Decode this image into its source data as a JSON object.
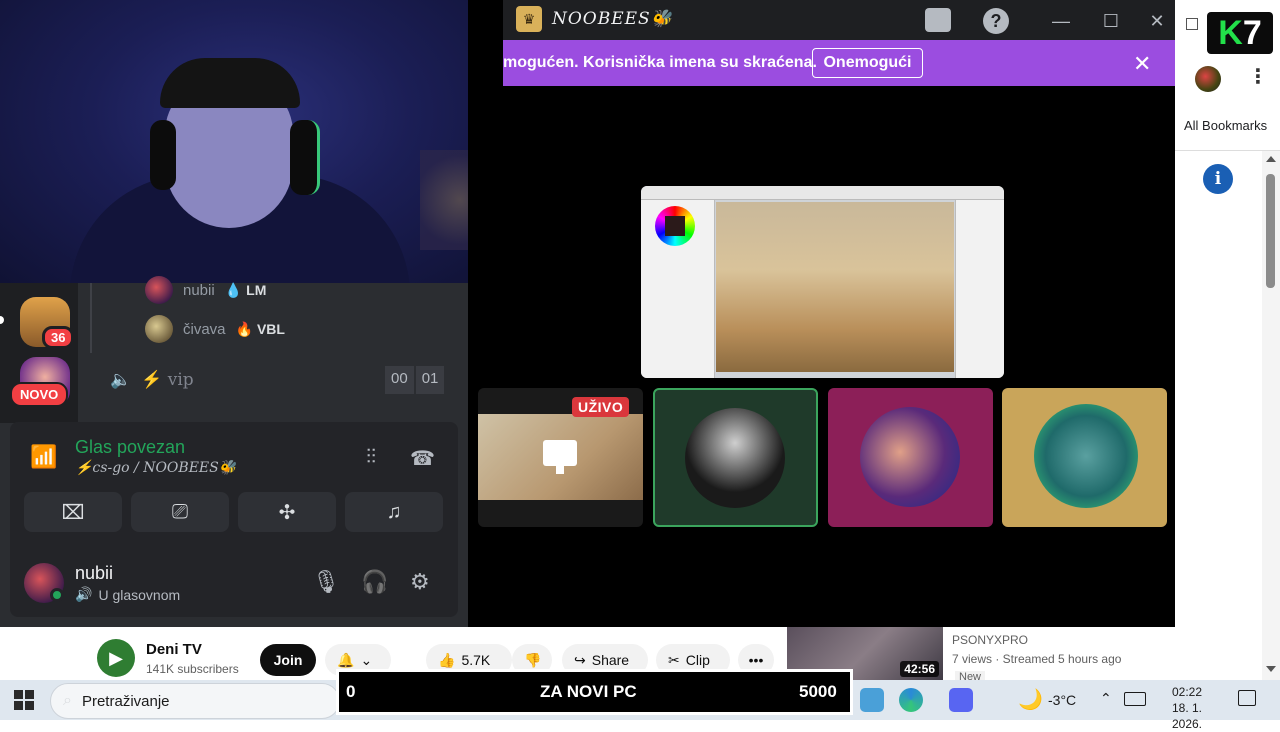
{
  "browser": {
    "bookmarks_label": "All Bookmarks",
    "k7_letter": "K",
    "k7_number": "7",
    "info_icon_glyph": "i",
    "kebab_glyph": "⋮"
  },
  "youtube": {
    "channel_name": "Deni TV",
    "subscribers": "141K subscribers",
    "join_label": "Join",
    "like_count": "5.7K",
    "share_label": "Share",
    "clip_label": "Clip",
    "more_glyph": "•••",
    "related": {
      "duration": "42:56",
      "channel": "PSONYXPRO",
      "meta": "7 views · Streamed 5 hours ago",
      "badge": "New"
    }
  },
  "discord": {
    "window_title": "NOOBEES🐝",
    "notice_text": "mogućen. Korisnička imena su skraćena.",
    "notice_button": "Onemogući",
    "notice_close": "✕",
    "server_badge_count": "36",
    "server_new_label": "NOVO",
    "voice_users": [
      {
        "name": "nubii",
        "tag": "LM",
        "tag_icon": "💧"
      },
      {
        "name": "čivava",
        "tag": "VBL",
        "tag_icon": "🔥"
      }
    ],
    "vip_channel": "⚡ vip",
    "vip_timer_left": "00",
    "vip_timer_right": "01",
    "voice_status_title": "Glas povezan",
    "voice_status_sub": "⚡cs-go / NOOBEES🐝",
    "user_name": "nubii",
    "user_sub": "U glasovnom",
    "live_badge": "UŽIVO"
  },
  "overlay": {
    "left_value": "0",
    "center_text": "ZA NOVI PC",
    "right_value": "5000"
  },
  "taskbar": {
    "search_placeholder": "Pretraživanje",
    "temperature": "-3°C",
    "time": "02:22",
    "date": "18. 1. 2026."
  },
  "colors": {
    "notice_bg": "#9b4de0",
    "discord_green": "#23a55a",
    "live_red": "#da373c",
    "tile_magenta": "#8c1f58",
    "tile_gold": "#c9a55a"
  }
}
